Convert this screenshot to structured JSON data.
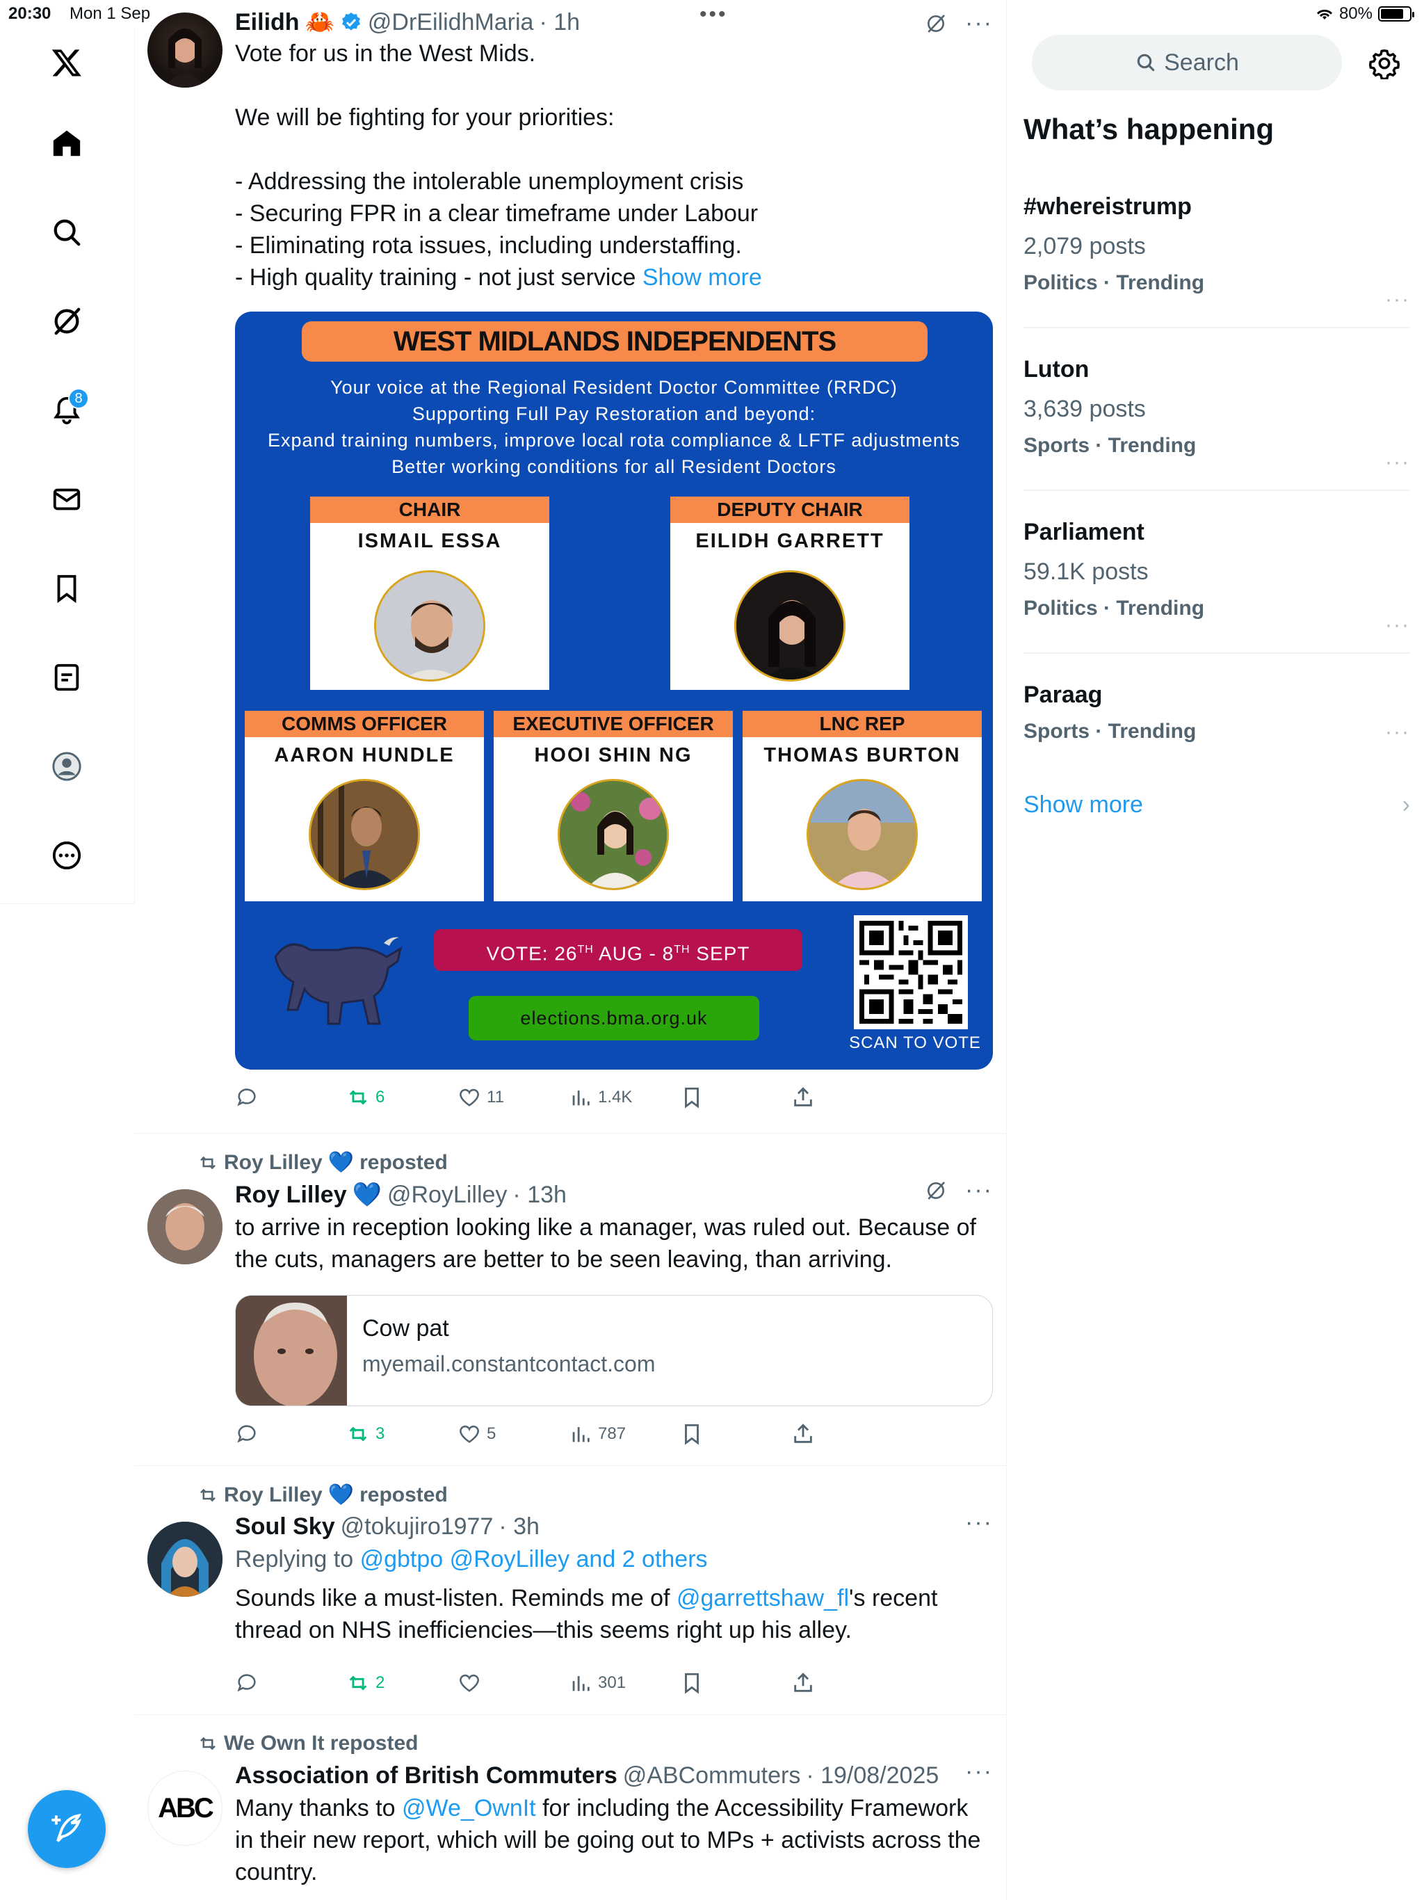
{
  "status_bar": {
    "time": "20:30",
    "date": "Mon 1 Sep",
    "battery": "80%",
    "battery_level": 0.8
  },
  "nav": {
    "notifications_badge": "8"
  },
  "tweets": [
    {
      "name": "Eilidh",
      "emoji": "🦀",
      "handle": "@DrEilidhMaria",
      "time": "· 1h",
      "lines": [
        "Vote for us in the West Mids.",
        "We will be fighting for your priorities:",
        "- Addressing the intolerable unemployment crisis",
        "- Securing FPR in a clear timeframe under Labour",
        "- Eliminating rota issues, including understaffing.",
        "- High quality training - not just service"
      ],
      "show_more": "Show more",
      "poster": {
        "title": "WEST MIDLANDS INDEPENDENTS",
        "lines": [
          "Your voice at the Regional Resident Doctor Committee (RRDC)",
          "Supporting Full Pay Restoration and beyond:",
          "Expand training numbers, improve local rota compliance & LFTF adjustments",
          "Better working conditions for all Resident Doctors"
        ],
        "roles": [
          {
            "role": "CHAIR",
            "name": "ISMAIL ESSA"
          },
          {
            "role": "DEPUTY CHAIR",
            "name": "EILIDH GARRETT"
          },
          {
            "role": "COMMS OFFICER",
            "name": "AARON HUNDLE"
          },
          {
            "role": "EXECUTIVE OFFICER",
            "name": "HOOI SHIN NG"
          },
          {
            "role": "LNC REP",
            "name": "THOMAS BURTON"
          }
        ],
        "vote_prefix": "VOTE: 26",
        "vote_sup1": "TH",
        "vote_mid": " AUG - 8",
        "vote_sup2": "TH",
        "vote_suffix": " SEPT",
        "site": "elections.bma.org.uk",
        "scan": "SCAN TO VOTE"
      },
      "stats": {
        "replies": "",
        "reposts": "6",
        "likes": "11",
        "views": "1.4K"
      }
    },
    {
      "reposted_by": "Roy Lilley",
      "reposted_label": "reposted",
      "name": "Roy Lilley",
      "handle": "@RoyLilley",
      "time": "· 13h",
      "text": "to arrive in reception looking like a manager, was ruled out. Because of the cuts, managers are better to be seen leaving, than arriving.",
      "card": {
        "title": "Cow pat",
        "domain": "myemail.constantcontact.com"
      },
      "stats": {
        "replies": "",
        "reposts": "3",
        "likes": "5",
        "views": "787"
      }
    },
    {
      "reposted_by": "Roy Lilley",
      "reposted_label": "reposted",
      "name": "Soul Sky",
      "handle": "@tokujiro1977",
      "time": "· 3h",
      "replying_to": "Replying to",
      "replying_handles": "@gbtpo @RoyLilley and 2 others",
      "text_before": "Sounds like a must-listen. Reminds me of ",
      "mention": "@garrettshaw_fl",
      "text_after": "'s recent thread on NHS inefficiencies—this seems right up his alley.",
      "stats": {
        "replies": "",
        "reposts": "2",
        "likes": "",
        "views": "301"
      }
    },
    {
      "reposted_by": "We Own It reposted",
      "name": "Association of British Commuters",
      "handle": "@ABCommuters",
      "time": "· 19/08/2025",
      "avatar_text": "ABC",
      "text_before": "Many thanks to ",
      "mention": "@We_OwnIt",
      "text_after": " for including the Accessibility Framework in their new report, which will be going out to MPs + activists across the country."
    }
  ],
  "right": {
    "search_placeholder": "Search",
    "section_title": "What’s happening",
    "trends": [
      {
        "name": "#whereistrump",
        "posts": "2,079 posts",
        "category": "Politics · Trending"
      },
      {
        "name": "Luton",
        "posts": "3,639 posts",
        "category": "Sports · Trending"
      },
      {
        "name": "Parliament",
        "posts": "59.1K posts",
        "category": "Politics · Trending"
      },
      {
        "name": "Paraag",
        "posts": "",
        "category": "Sports · Trending"
      }
    ],
    "show_more": "Show more"
  },
  "colors": {
    "accent": "#1d9bf0",
    "repost_green": "#00ba7c",
    "poster_blue": "#0b4bb3",
    "poster_orange": "#f7894a",
    "vote_red": "#b7124f",
    "site_green": "#2aa60a"
  }
}
